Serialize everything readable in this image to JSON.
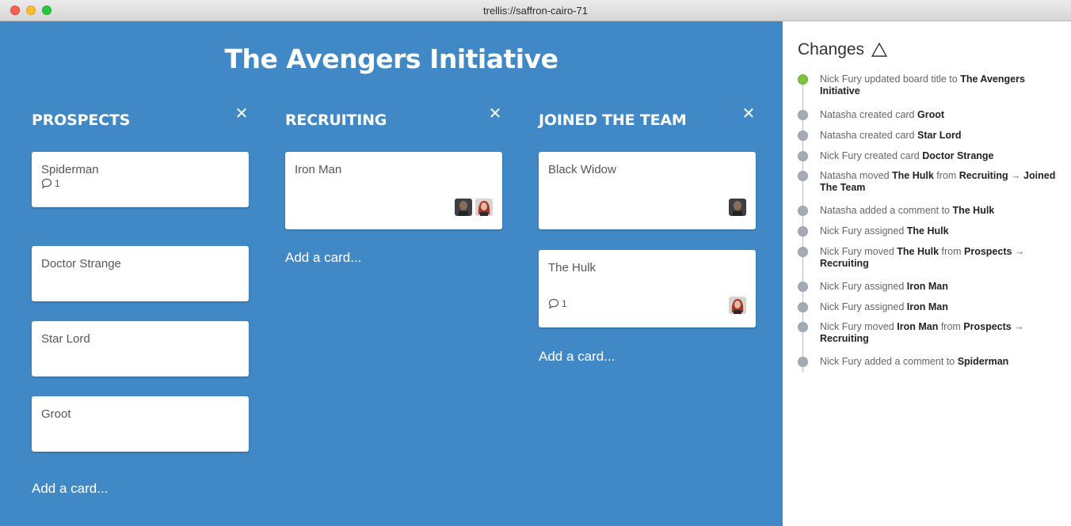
{
  "window": {
    "title": "trellis://saffron-cairo-71"
  },
  "board": {
    "title": "The Avengers Initiative",
    "close_glyph": "✕",
    "add_card_label": "Add a card...",
    "lists": [
      {
        "title": "PROSPECTS",
        "cards": [
          {
            "title": "Spiderman",
            "comments": "1",
            "avatars": []
          },
          {
            "title": "Doctor Strange",
            "comments": null,
            "avatars": []
          },
          {
            "title": "Star Lord",
            "comments": null,
            "avatars": []
          },
          {
            "title": "Groot",
            "comments": null,
            "avatars": []
          }
        ]
      },
      {
        "title": "RECRUITING",
        "cards": [
          {
            "title": "Iron Man",
            "comments": null,
            "avatars": [
              "man",
              "woman"
            ]
          }
        ]
      },
      {
        "title": "JOINED THE TEAM",
        "cards": [
          {
            "title": "Black Widow",
            "comments": null,
            "avatars": [
              "man"
            ]
          },
          {
            "title": "The Hulk",
            "comments": "1",
            "avatars": [
              "woman"
            ]
          }
        ]
      }
    ]
  },
  "changes": {
    "title": "Changes",
    "title_icon": "delta-icon",
    "items": [
      {
        "parts": [
          {
            "t": "Nick Fury updated board title to ",
            "b": false
          },
          {
            "t": "The Avengers Initiative",
            "b": true
          }
        ]
      },
      {
        "parts": [
          {
            "t": "Natasha created card ",
            "b": false
          },
          {
            "t": "Groot",
            "b": true
          }
        ]
      },
      {
        "parts": [
          {
            "t": "Natasha created card ",
            "b": false
          },
          {
            "t": "Star Lord",
            "b": true
          }
        ]
      },
      {
        "parts": [
          {
            "t": "Nick Fury created card ",
            "b": false
          },
          {
            "t": "Doctor Strange",
            "b": true
          }
        ]
      },
      {
        "parts": [
          {
            "t": "Natasha moved ",
            "b": false
          },
          {
            "t": "The Hulk",
            "b": true
          },
          {
            "t": " from ",
            "b": false
          },
          {
            "t": "Recruiting",
            "b": true
          },
          {
            "t": " → ",
            "b": false
          },
          {
            "t": "Joined The Team",
            "b": true
          }
        ]
      },
      {
        "parts": [
          {
            "t": "Natasha added a comment to ",
            "b": false
          },
          {
            "t": "The Hulk",
            "b": true
          }
        ]
      },
      {
        "parts": [
          {
            "t": "Nick Fury assigned ",
            "b": false
          },
          {
            "t": "The Hulk",
            "b": true
          }
        ]
      },
      {
        "parts": [
          {
            "t": "Nick Fury moved ",
            "b": false
          },
          {
            "t": "The Hulk",
            "b": true
          },
          {
            "t": " from ",
            "b": false
          },
          {
            "t": "Prospects",
            "b": true
          },
          {
            "t": " → ",
            "b": false
          },
          {
            "t": "Recruiting",
            "b": true
          }
        ]
      },
      {
        "parts": [
          {
            "t": "Nick Fury assigned ",
            "b": false
          },
          {
            "t": "Iron Man",
            "b": true
          }
        ]
      },
      {
        "parts": [
          {
            "t": "Nick Fury assigned ",
            "b": false
          },
          {
            "t": "Iron Man",
            "b": true
          }
        ]
      },
      {
        "parts": [
          {
            "t": "Nick Fury moved ",
            "b": false
          },
          {
            "t": "Iron Man",
            "b": true
          },
          {
            "t": " from ",
            "b": false
          },
          {
            "t": "Prospects",
            "b": true
          },
          {
            "t": " → ",
            "b": false
          },
          {
            "t": "Recruiting",
            "b": true
          }
        ]
      },
      {
        "parts": [
          {
            "t": "Nick Fury added a comment to ",
            "b": false
          },
          {
            "t": "Spiderman",
            "b": true
          }
        ]
      }
    ]
  },
  "colors": {
    "board_bg": "#4189c6",
    "first_dot": "#7ec23f",
    "dot": "#a4abb5"
  }
}
